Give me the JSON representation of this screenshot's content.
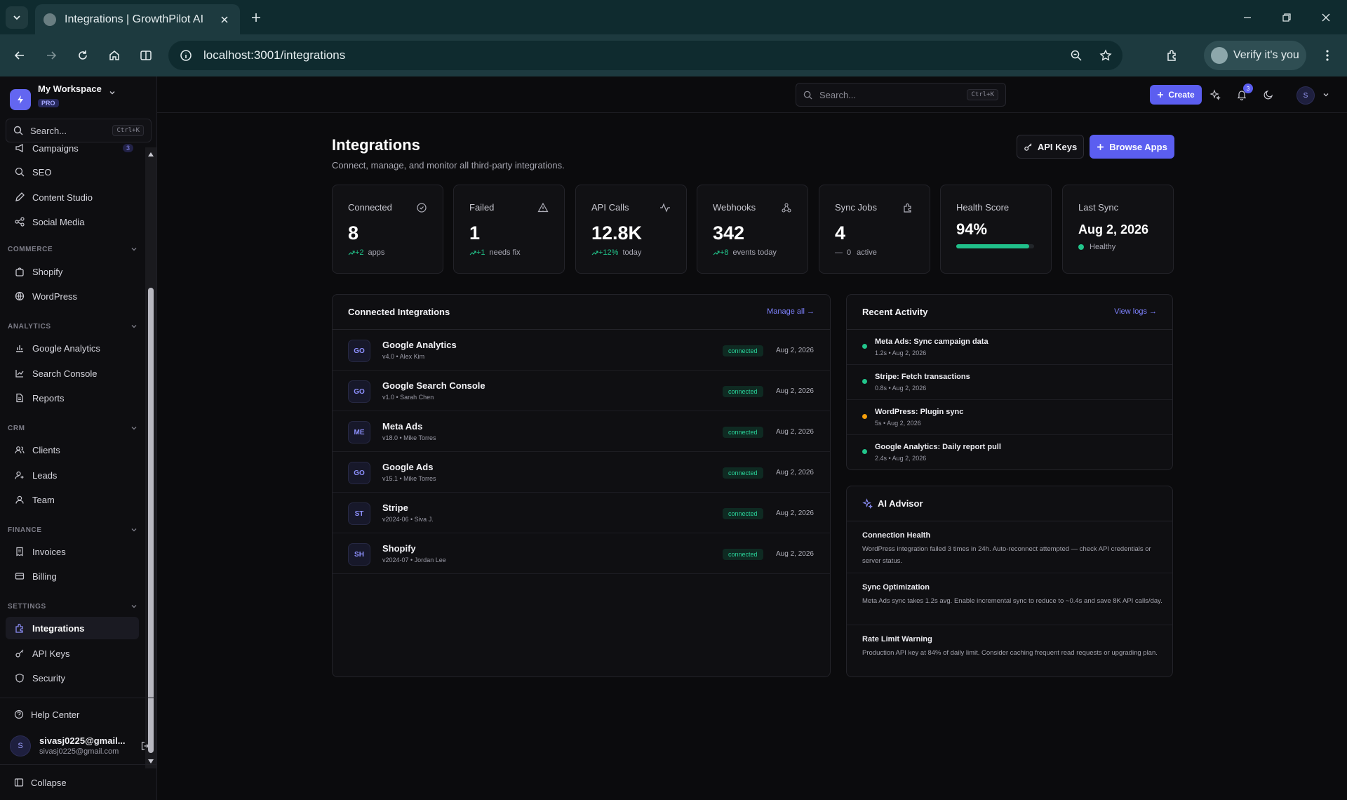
{
  "browser": {
    "tab_title": "Integrations | GrowthPilot AI",
    "url": "localhost:3001/integrations",
    "profile_label": "Verify it's you"
  },
  "workspace": {
    "name": "My Workspace",
    "plan": "PRO"
  },
  "sidebar": {
    "search_placeholder": "Search...",
    "search_shortcut": "Ctrl+K",
    "partial_item": {
      "label": "Campaigns",
      "badge": "3"
    },
    "items_marketing": [
      {
        "label": "SEO",
        "icon": "search-icon"
      },
      {
        "label": "Content Studio",
        "icon": "pen-icon"
      },
      {
        "label": "Social Media",
        "icon": "share-icon"
      }
    ],
    "sections": [
      {
        "label": "COMMERCE",
        "items": [
          {
            "label": "Shopify",
            "icon": "bag-icon"
          },
          {
            "label": "WordPress",
            "icon": "globe-icon"
          }
        ]
      },
      {
        "label": "ANALYTICS",
        "items": [
          {
            "label": "Google Analytics",
            "icon": "bar-chart-icon"
          },
          {
            "label": "Search Console",
            "icon": "line-chart-icon"
          },
          {
            "label": "Reports",
            "icon": "file-icon"
          }
        ]
      },
      {
        "label": "CRM",
        "items": [
          {
            "label": "Clients",
            "icon": "users-icon"
          },
          {
            "label": "Leads",
            "icon": "user-plus-icon"
          },
          {
            "label": "Team",
            "icon": "user-icon"
          }
        ]
      },
      {
        "label": "FINANCE",
        "items": [
          {
            "label": "Invoices",
            "icon": "receipt-icon"
          },
          {
            "label": "Billing",
            "icon": "credit-card-icon"
          }
        ]
      },
      {
        "label": "SETTINGS",
        "items": [
          {
            "label": "Integrations",
            "icon": "puzzle-icon",
            "active": true
          },
          {
            "label": "API Keys",
            "icon": "key-icon"
          },
          {
            "label": "Security",
            "icon": "shield-icon"
          }
        ]
      }
    ],
    "help_label": "Help Center",
    "user": {
      "avatar": "S",
      "name": "sivasj0225@gmail...",
      "email": "sivasj0225@gmail.com"
    },
    "collapse_label": "Collapse"
  },
  "topbar": {
    "search_placeholder": "Search...",
    "search_shortcut": "Ctrl+K",
    "create_label": "Create",
    "notification_count": "3",
    "avatar": "S"
  },
  "page": {
    "title": "Integrations",
    "subtitle": "Connect, manage, and monitor all third-party integrations.",
    "api_keys_label": "API Keys",
    "browse_label": "Browse Apps"
  },
  "stats": {
    "connected": {
      "label": "Connected",
      "value": "8",
      "delta": "+2",
      "note": "apps"
    },
    "failed": {
      "label": "Failed",
      "value": "1",
      "delta": "+1",
      "note": "needs fix"
    },
    "api_calls": {
      "label": "API Calls",
      "value": "12.8K",
      "delta": "+12%",
      "note": "today"
    },
    "webhooks": {
      "label": "Webhooks",
      "value": "342",
      "delta": "+8",
      "note": "events today"
    },
    "sync_jobs": {
      "label": "Sync Jobs",
      "value": "4",
      "delta": "0",
      "note": "active"
    },
    "health": {
      "label": "Health Score",
      "value": "94%",
      "progress": 0.94
    },
    "last_sync": {
      "label": "Last Sync",
      "value": "Aug 2, 2026",
      "status": "Healthy"
    }
  },
  "integrations_panel": {
    "title": "Connected Integrations",
    "manage_label": "Manage all →",
    "rows": [
      {
        "avatar": "GO",
        "name": "Google Analytics",
        "meta": "v4.0 • Alex Kim",
        "status": "connected",
        "date": "Aug 2, 2026"
      },
      {
        "avatar": "GO",
        "name": "Google Search Console",
        "meta": "v1.0 • Sarah Chen",
        "status": "connected",
        "date": "Aug 2, 2026"
      },
      {
        "avatar": "ME",
        "name": "Meta Ads",
        "meta": "v18.0 • Mike Torres",
        "status": "connected",
        "date": "Aug 2, 2026"
      },
      {
        "avatar": "GO",
        "name": "Google Ads",
        "meta": "v15.1 • Mike Torres",
        "status": "connected",
        "date": "Aug 2, 2026"
      },
      {
        "avatar": "ST",
        "name": "Stripe",
        "meta": "v2024-06 • Siva J.",
        "status": "connected",
        "date": "Aug 2, 2026"
      },
      {
        "avatar": "SH",
        "name": "Shopify",
        "meta": "v2024-07 • Jordan Lee",
        "status": "connected",
        "date": "Aug 2, 2026"
      }
    ]
  },
  "activity_panel": {
    "title": "Recent Activity",
    "view_label": "View logs →",
    "rows": [
      {
        "title": "Meta Ads: Sync campaign data",
        "meta": "1.2s • Aug 2, 2026",
        "color": "#22c58b"
      },
      {
        "title": "Stripe: Fetch transactions",
        "meta": "0.8s • Aug 2, 2026",
        "color": "#22c58b"
      },
      {
        "title": "WordPress: Plugin sync",
        "meta": "5s • Aug 2, 2026",
        "color": "#f59e0b"
      },
      {
        "title": "Google Analytics: Daily report pull",
        "meta": "2.4s • Aug 2, 2026",
        "color": "#22c58b"
      }
    ]
  },
  "advisor_panel": {
    "title": "AI Advisor",
    "rows": [
      {
        "title": "Connection Health",
        "text": "WordPress integration failed 3 times in 24h. Auto-reconnect attempted — check API credentials or server status."
      },
      {
        "title": "Sync Optimization",
        "text": "Meta Ads sync takes 1.2s avg. Enable incremental sync to reduce to ~0.4s and save 8K API calls/day."
      },
      {
        "title": "Rate Limit Warning",
        "text": "Production API key at 84% of daily limit. Consider caching frequent read requests or upgrading plan."
      }
    ]
  },
  "colors": {
    "accent": "#5b5ef0",
    "success": "#22c58b",
    "warning": "#f59e0b"
  }
}
